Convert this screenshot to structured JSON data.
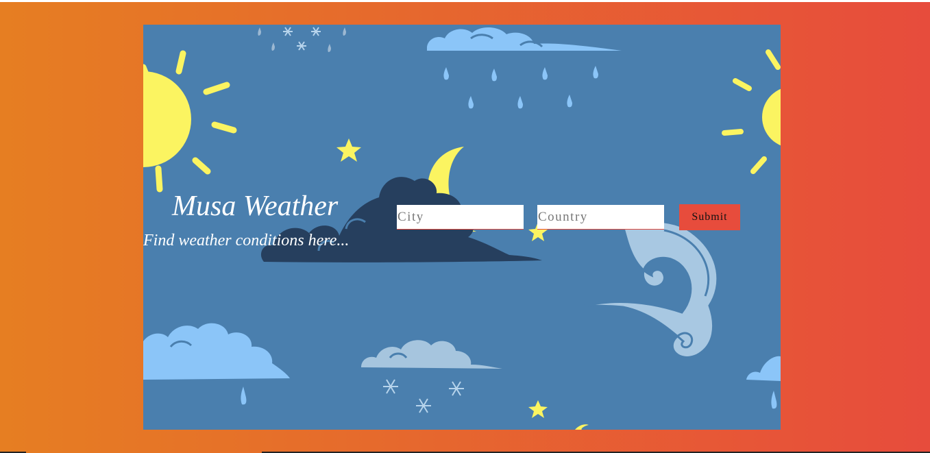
{
  "app": {
    "title": "Musa Weather",
    "subtitle": "Find weather conditions here..."
  },
  "form": {
    "city_placeholder": "City",
    "city_value": "",
    "country_placeholder": "Country",
    "country_value": "",
    "submit_label": "Submit"
  },
  "colors": {
    "gradient_start": "#e67e22",
    "gradient_end": "#e74c3c",
    "panel": "#4a7fae",
    "button": "#e74c3c",
    "sun": "#fbf461",
    "cloud_light": "#8bc5f8",
    "cloud_dark": "#263f5e",
    "cloud_pale": "#a6c5de"
  },
  "background_icons": [
    "sun-icon",
    "moon-icon",
    "star-icon",
    "cloud-icon",
    "raindrop-icon",
    "snowflake-icon",
    "wind-swirl-icon"
  ]
}
